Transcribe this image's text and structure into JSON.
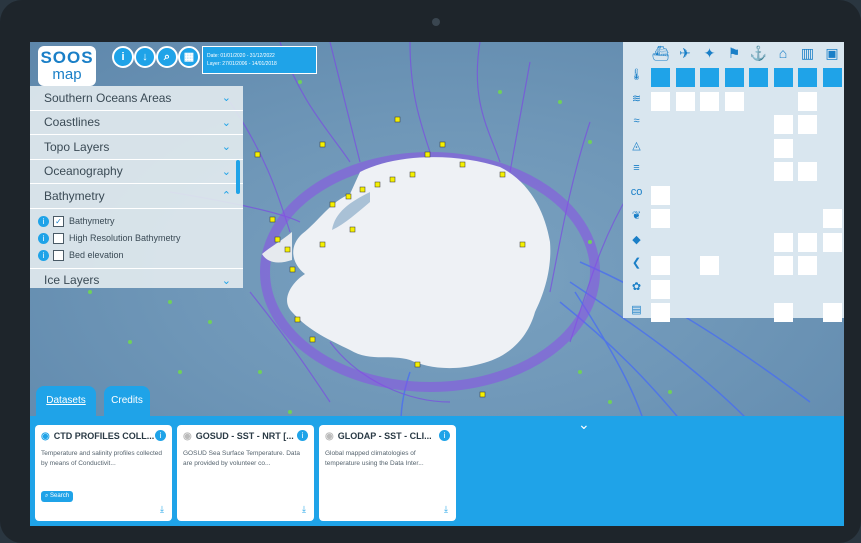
{
  "logo": {
    "line1": "SOOS",
    "line2": "map"
  },
  "toolbar": {
    "info_icon": "i",
    "download_icon": "↓",
    "search_icon": "⌕",
    "calendar_icon": "▦",
    "date_line": "Date: 01/01/2020 - 31/12/2022",
    "layer_line": "Layer: 27/01/2006 - 14/01/2018"
  },
  "layers": {
    "groups": [
      {
        "label": "Southern Oceans Areas",
        "chev": "⌄"
      },
      {
        "label": "Coastlines",
        "chev": "⌄"
      },
      {
        "label": "Topo Layers",
        "chev": "⌄"
      },
      {
        "label": "Oceanography",
        "chev": "⌄"
      },
      {
        "label": "Bathymetry",
        "chev": "⌃"
      }
    ],
    "bathymetry_items": [
      {
        "label": "Bathymetry",
        "checked": "✓"
      },
      {
        "label": "High Resolution Bathymetry",
        "checked": ""
      },
      {
        "label": "Bed elevation",
        "checked": ""
      }
    ],
    "last_group": {
      "label": "Ice Layers",
      "chev": "⌄"
    }
  },
  "grid": {
    "platform_icons": [
      "ship-icon",
      "glider-icon",
      "animal-icon",
      "float-icon",
      "mooring-icon",
      "station-icon",
      "map-icon",
      "other-icon"
    ],
    "variable_icons": [
      "temperature-icon",
      "salinity-icon",
      "wave-icon",
      "ice-icon",
      "wind-icon",
      "co2-icon",
      "biology-icon",
      "nutrient-icon",
      "fish-icon",
      "plant-icon",
      "book-icon"
    ],
    "accent": "#1fa3e8"
  },
  "tabs": {
    "datasets": "Datasets",
    "credits": "Credits"
  },
  "cards": [
    {
      "title": "CTD PROFILES COLL...",
      "desc": "Temperature and salinity profiles collected by means of Conductivit...",
      "search": "Search",
      "active": true
    },
    {
      "title": "GOSUD - SST - NRT [...",
      "desc": "GOSUD Sea Surface Temperature. Data are provided by volunteer co...",
      "search": "",
      "active": false
    },
    {
      "title": "GLODAP - SST - CLI...",
      "desc": "Global mapped climatologies of temperature using the Data Inter...",
      "search": "",
      "active": false
    }
  ]
}
